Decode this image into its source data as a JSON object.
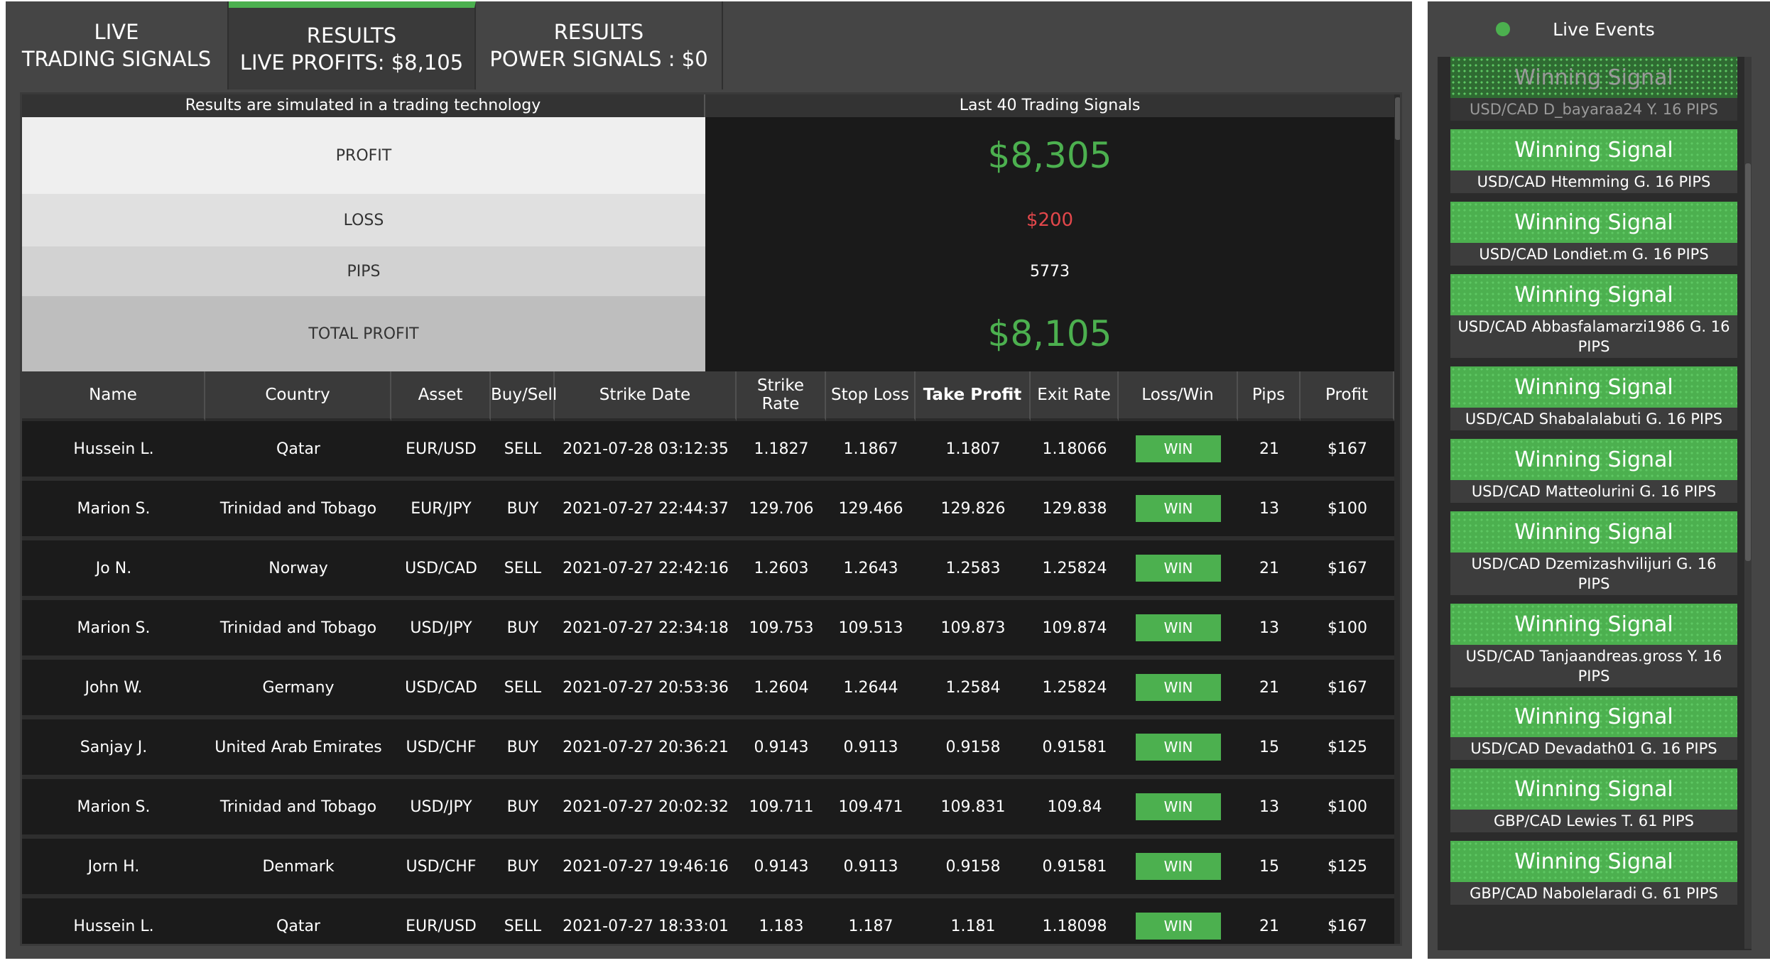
{
  "tabs": {
    "live": {
      "line1": "LIVE",
      "line2": "TRADING SIGNALS"
    },
    "results": {
      "line1": "RESULTS",
      "line2": "LIVE PROFITS: $8,105"
    },
    "power": {
      "line1": "RESULTS",
      "line2": "POWER SIGNALS : $0"
    }
  },
  "summary": {
    "left_header": "Results are simulated in a trading technology",
    "right_header": "Last 40 Trading Signals",
    "profit_label": "PROFIT",
    "profit_value": "$8,305",
    "loss_label": "LOSS",
    "loss_value": "$200",
    "pips_label": "PIPS",
    "pips_value": "5773",
    "total_label": "TOTAL PROFIT",
    "total_value": "$8,105"
  },
  "table": {
    "headers": [
      "Name",
      "Country",
      "Asset",
      "Buy/Sell",
      "Strike Date",
      "Strike Rate",
      "Stop Loss",
      "Take Profit",
      "Exit Rate",
      "Loss/Win",
      "Pips",
      "Profit"
    ],
    "rows": [
      {
        "name": "Hussein L.",
        "country": "Qatar",
        "asset": "EUR/USD",
        "side": "SELL",
        "date": "2021-07-28 03:12:35",
        "strike": "1.1827",
        "stop": "1.1867",
        "take": "1.1807",
        "exit": "1.18066",
        "result": "WIN",
        "pips": "21",
        "profit": "$167"
      },
      {
        "name": "Marion S.",
        "country": "Trinidad and Tobago",
        "asset": "EUR/JPY",
        "side": "BUY",
        "date": "2021-07-27 22:44:37",
        "strike": "129.706",
        "stop": "129.466",
        "take": "129.826",
        "exit": "129.838",
        "result": "WIN",
        "pips": "13",
        "profit": "$100"
      },
      {
        "name": "Jo N.",
        "country": "Norway",
        "asset": "USD/CAD",
        "side": "SELL",
        "date": "2021-07-27 22:42:16",
        "strike": "1.2603",
        "stop": "1.2643",
        "take": "1.2583",
        "exit": "1.25824",
        "result": "WIN",
        "pips": "21",
        "profit": "$167"
      },
      {
        "name": "Marion S.",
        "country": "Trinidad and Tobago",
        "asset": "USD/JPY",
        "side": "BUY",
        "date": "2021-07-27 22:34:18",
        "strike": "109.753",
        "stop": "109.513",
        "take": "109.873",
        "exit": "109.874",
        "result": "WIN",
        "pips": "13",
        "profit": "$100"
      },
      {
        "name": "John W.",
        "country": "Germany",
        "asset": "USD/CAD",
        "side": "SELL",
        "date": "2021-07-27 20:53:36",
        "strike": "1.2604",
        "stop": "1.2644",
        "take": "1.2584",
        "exit": "1.25824",
        "result": "WIN",
        "pips": "21",
        "profit": "$167"
      },
      {
        "name": "Sanjay J.",
        "country": "United Arab Emirates",
        "asset": "USD/CHF",
        "side": "BUY",
        "date": "2021-07-27 20:36:21",
        "strike": "0.9143",
        "stop": "0.9113",
        "take": "0.9158",
        "exit": "0.91581",
        "result": "WIN",
        "pips": "15",
        "profit": "$125"
      },
      {
        "name": "Marion S.",
        "country": "Trinidad and Tobago",
        "asset": "USD/JPY",
        "side": "BUY",
        "date": "2021-07-27 20:02:32",
        "strike": "109.711",
        "stop": "109.471",
        "take": "109.831",
        "exit": "109.84",
        "result": "WIN",
        "pips": "13",
        "profit": "$100"
      },
      {
        "name": "Jorn H.",
        "country": "Denmark",
        "asset": "USD/CHF",
        "side": "BUY",
        "date": "2021-07-27 19:46:16",
        "strike": "0.9143",
        "stop": "0.9113",
        "take": "0.9158",
        "exit": "0.91581",
        "result": "WIN",
        "pips": "15",
        "profit": "$125"
      },
      {
        "name": "Hussein L.",
        "country": "Qatar",
        "asset": "EUR/USD",
        "side": "SELL",
        "date": "2021-07-27 18:33:01",
        "strike": "1.183",
        "stop": "1.187",
        "take": "1.181",
        "exit": "1.18098",
        "result": "WIN",
        "pips": "21",
        "profit": "$167"
      }
    ]
  },
  "events": {
    "title": "Live Events",
    "items": [
      {
        "title": "Winning Signal",
        "text": "USD/CAD D_bayaraa24 Y. 16 PIPS"
      },
      {
        "title": "Winning Signal",
        "text": "USD/CAD Htemming G. 16 PIPS"
      },
      {
        "title": "Winning Signal",
        "text": "USD/CAD Londiet.m G. 16 PIPS"
      },
      {
        "title": "Winning Signal",
        "text": "USD/CAD Abbasfalamarzi1986 G. 16 PIPS"
      },
      {
        "title": "Winning Signal",
        "text": "USD/CAD Shabalalabuti G. 16 PIPS"
      },
      {
        "title": "Winning Signal",
        "text": "USD/CAD Matteolurini G. 16 PIPS"
      },
      {
        "title": "Winning Signal",
        "text": "USD/CAD Dzemizashvilijuri G. 16 PIPS"
      },
      {
        "title": "Winning Signal",
        "text": "USD/CAD Tanjaandreas.gross Y. 16 PIPS"
      },
      {
        "title": "Winning Signal",
        "text": "USD/CAD Devadath01 G. 16 PIPS"
      },
      {
        "title": "Winning Signal",
        "text": "GBP/CAD Lewies T. 61 PIPS"
      },
      {
        "title": "Winning Signal",
        "text": "GBP/CAD Nabolelaradi G. 61 PIPS"
      }
    ]
  },
  "colors": {
    "accent_green": "#4cb04f",
    "loss_red": "#e2474b",
    "panel_bg": "#454545",
    "table_bg": "#1b1b1b"
  }
}
